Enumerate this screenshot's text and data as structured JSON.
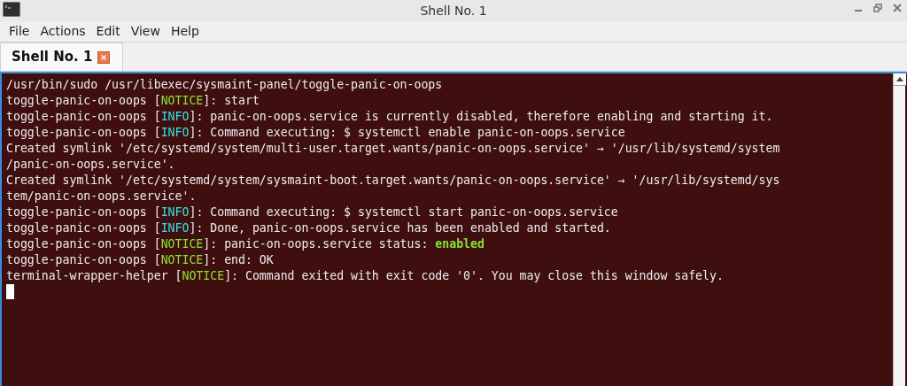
{
  "window": {
    "title": "Shell No. 1"
  },
  "menu": [
    "File",
    "Actions",
    "Edit",
    "View",
    "Help"
  ],
  "tabs": [
    {
      "label": "Shell No. 1",
      "selected": true
    }
  ],
  "terminal": {
    "lines": [
      [
        {
          "kind": "plain",
          "text": "/usr/bin/sudo /usr/libexec/sysmaint-panel/toggle-panic-on-oops"
        }
      ],
      [
        {
          "kind": "plain",
          "text": "toggle-panic-on-oops ["
        },
        {
          "kind": "notice",
          "text": "NOTICE"
        },
        {
          "kind": "plain",
          "text": "]: start"
        }
      ],
      [
        {
          "kind": "plain",
          "text": "toggle-panic-on-oops ["
        },
        {
          "kind": "info",
          "text": "INFO"
        },
        {
          "kind": "plain",
          "text": "]: panic-on-oops.service is currently disabled, therefore enabling and starting it."
        }
      ],
      [
        {
          "kind": "plain",
          "text": "toggle-panic-on-oops ["
        },
        {
          "kind": "info",
          "text": "INFO"
        },
        {
          "kind": "plain",
          "text": "]: Command executing: $ systemctl enable panic-on-oops.service"
        }
      ],
      [
        {
          "kind": "plain",
          "text": "Created symlink '/etc/systemd/system/multi-user.target.wants/panic-on-oops.service' → '/usr/lib/systemd/system"
        }
      ],
      [
        {
          "kind": "plain",
          "text": "/panic-on-oops.service'."
        }
      ],
      [
        {
          "kind": "plain",
          "text": "Created symlink '/etc/systemd/system/sysmaint-boot.target.wants/panic-on-oops.service' → '/usr/lib/systemd/sys"
        }
      ],
      [
        {
          "kind": "plain",
          "text": "tem/panic-on-oops.service'."
        }
      ],
      [
        {
          "kind": "plain",
          "text": "toggle-panic-on-oops ["
        },
        {
          "kind": "info",
          "text": "INFO"
        },
        {
          "kind": "plain",
          "text": "]: Command executing: $ systemctl start panic-on-oops.service"
        }
      ],
      [
        {
          "kind": "plain",
          "text": "toggle-panic-on-oops ["
        },
        {
          "kind": "info",
          "text": "INFO"
        },
        {
          "kind": "plain",
          "text": "]: Done, panic-on-oops.service has been enabled and started."
        }
      ],
      [
        {
          "kind": "plain",
          "text": "toggle-panic-on-oops ["
        },
        {
          "kind": "notice",
          "text": "NOTICE"
        },
        {
          "kind": "plain",
          "text": "]: panic-on-oops.service status: "
        },
        {
          "kind": "ok",
          "text": "enabled"
        }
      ],
      [
        {
          "kind": "plain",
          "text": "toggle-panic-on-oops ["
        },
        {
          "kind": "notice",
          "text": "NOTICE"
        },
        {
          "kind": "plain",
          "text": "]: end: OK"
        }
      ],
      [
        {
          "kind": "plain",
          "text": "terminal-wrapper-helper ["
        },
        {
          "kind": "notice",
          "text": "NOTICE"
        },
        {
          "kind": "plain",
          "text": "]: Command exited with exit code '0'. You may close this window safely."
        }
      ]
    ]
  }
}
